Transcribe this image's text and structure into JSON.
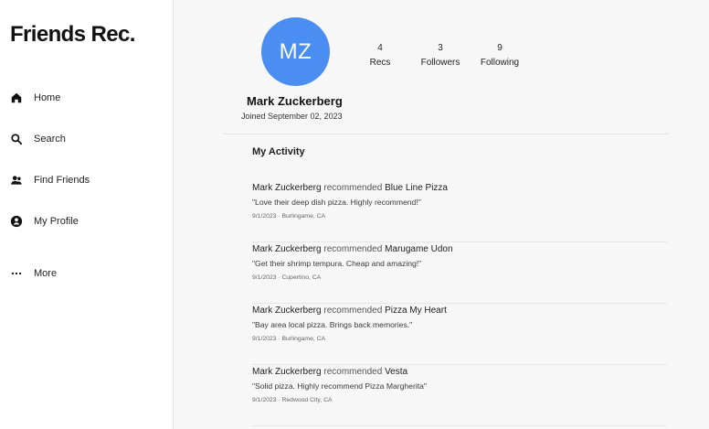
{
  "app": {
    "title": "Friends Rec."
  },
  "sidebar": {
    "items": [
      {
        "label": "Home",
        "icon": "home-icon"
      },
      {
        "label": "Search",
        "icon": "search-icon"
      },
      {
        "label": "Find Friends",
        "icon": "users-icon"
      },
      {
        "label": "My Profile",
        "icon": "profile-icon"
      },
      {
        "label": "More",
        "icon": "more-icon"
      }
    ]
  },
  "profile": {
    "initials": "MZ",
    "name": "Mark Zuckerberg",
    "joined": "Joined September 02, 2023",
    "stats": {
      "recs": {
        "value": "4",
        "label": "Recs"
      },
      "followers": {
        "value": "3",
        "label": "Followers"
      },
      "following": {
        "value": "9",
        "label": "Following"
      }
    },
    "avatar_color": "#4a8ef2"
  },
  "activity": {
    "title": "My Activity",
    "items": [
      {
        "actor": "Mark Zuckerberg",
        "verb": "recommended",
        "place": "Blue Line Pizza",
        "quote": "\"Love their deep dish pizza. Highly recommend!\"",
        "meta": "9/1/2023 · Burlingame, CA"
      },
      {
        "actor": "Mark Zuckerberg",
        "verb": "recommended",
        "place": "Marugame Udon",
        "quote": "\"Get their shrimp tempura. Cheap and amazing!\"",
        "meta": "9/1/2023 · Cupertino, CA"
      },
      {
        "actor": "Mark Zuckerberg",
        "verb": "recommended",
        "place": "Pizza My Heart",
        "quote": "\"Bay area local pizza. Brings back memories.\"",
        "meta": "9/1/2023 · Burlingame, CA"
      },
      {
        "actor": "Mark Zuckerberg",
        "verb": "recommended",
        "place": "Vesta",
        "quote": "\"Solid pizza. Highly recommend Pizza Margherita\"",
        "meta": "9/1/2023 · Redwood City, CA"
      }
    ]
  }
}
